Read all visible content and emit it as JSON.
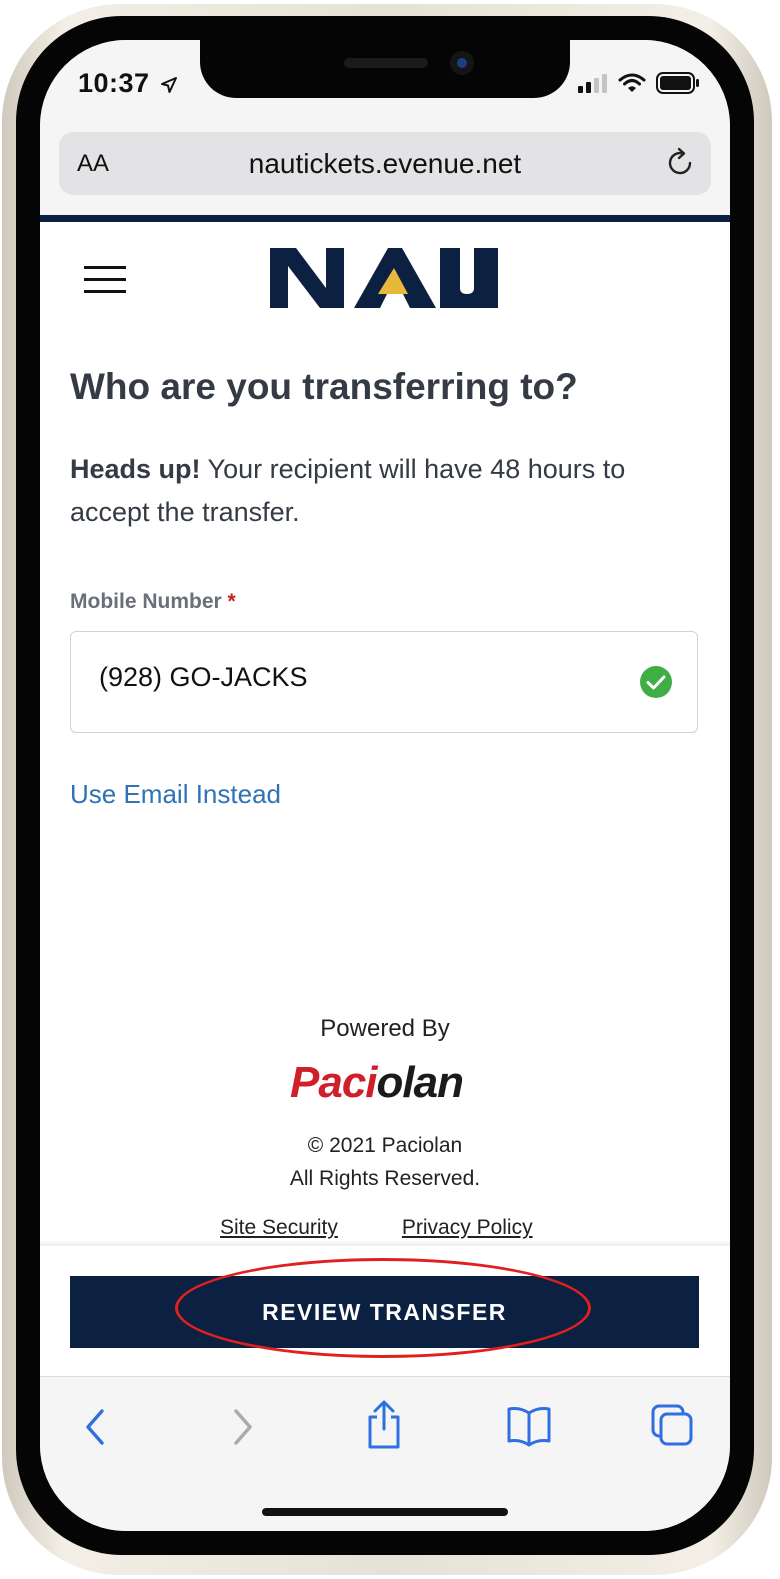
{
  "status_bar": {
    "time": "10:37"
  },
  "browser": {
    "text_size_label": "AA",
    "url": "nautickets.evenue.net"
  },
  "page": {
    "logo_text": "NAU",
    "heading": "Who are you transferring to?",
    "note_bold": "Heads up!",
    "note_text": " Your recipient will have 48 hours to accept the transfer.",
    "mobile_label": "Mobile Number",
    "required_marker": "*",
    "mobile_value": "(928) GO-JACKS",
    "use_email_link": "Use Email Instead"
  },
  "footer": {
    "powered_by": "Powered By",
    "brand_part1": "Paci",
    "brand_part2": "olan",
    "copyright": "© 2021 Paciolan",
    "rights": "All Rights Reserved.",
    "site_security": "Site Security",
    "privacy_policy": "Privacy Policy"
  },
  "action": {
    "review_button": "REVIEW TRANSFER"
  },
  "colors": {
    "navy": "#0c2142",
    "gold": "#e7b83a",
    "link_blue": "#2f73b4",
    "success_green": "#3fae45",
    "annotation_red": "#e02020"
  },
  "icons": [
    "location-arrow-icon",
    "signal-icon",
    "wifi-icon",
    "battery-icon",
    "reload-icon",
    "hamburger-menu-icon",
    "check-circle-icon",
    "back-icon",
    "forward-icon",
    "share-icon",
    "bookmarks-icon",
    "tabs-icon"
  ]
}
